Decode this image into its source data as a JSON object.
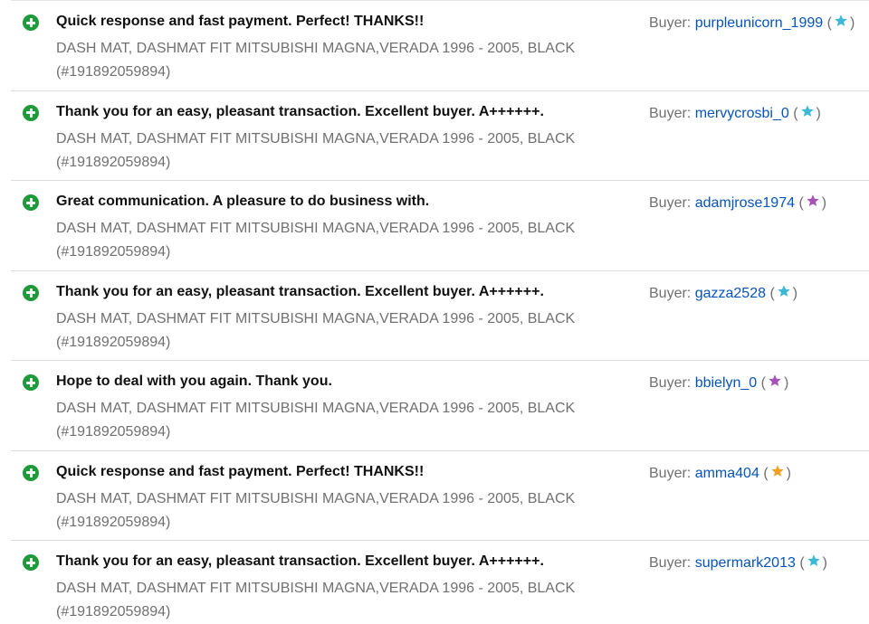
{
  "buyer_label": "Buyer:",
  "feedback": [
    {
      "comment": "Quick response and fast payment. Perfect! THANKS!!",
      "item_title": "DASH MAT, DASHMAT FIT MITSUBISHI MAGNA,VERADA 1996 - 2005, BLACK",
      "item_number": "(#191892059894)",
      "buyer": "purpleunicorn_1999",
      "star_color": "#3bb9d6",
      "icon": "positive-feedback-icon"
    },
    {
      "comment": "Thank you for an easy, pleasant transaction. Excellent buyer. A++++++.",
      "item_title": "DASH MAT, DASHMAT FIT MITSUBISHI MAGNA,VERADA 1996 - 2005, BLACK",
      "item_number": "(#191892059894)",
      "buyer": "mervycrosbi_0",
      "star_color": "#3bb9d6",
      "icon": "positive-feedback-icon"
    },
    {
      "comment": "Great communication. A pleasure to do business with.",
      "item_title": "DASH MAT, DASHMAT FIT MITSUBISHI MAGNA,VERADA 1996 - 2005, BLACK",
      "item_number": "(#191892059894)",
      "buyer": "adamjrose1974",
      "star_color": "#a650b8",
      "icon": "positive-feedback-icon"
    },
    {
      "comment": "Thank you for an easy, pleasant transaction. Excellent buyer. A++++++.",
      "item_title": "DASH MAT, DASHMAT FIT MITSUBISHI MAGNA,VERADA 1996 - 2005, BLACK",
      "item_number": "(#191892059894)",
      "buyer": "gazza2528",
      "star_color": "#3bb9d6",
      "icon": "positive-feedback-icon"
    },
    {
      "comment": "Hope to deal with you again. Thank you.",
      "item_title": "DASH MAT, DASHMAT FIT MITSUBISHI MAGNA,VERADA 1996 - 2005, BLACK",
      "item_number": "(#191892059894)",
      "buyer": "bbielyn_0",
      "star_color": "#a650b8",
      "icon": "positive-feedback-icon"
    },
    {
      "comment": "Quick response and fast payment. Perfect! THANKS!!",
      "item_title": "DASH MAT, DASHMAT FIT MITSUBISHI MAGNA,VERADA 1996 - 2005, BLACK",
      "item_number": "(#191892059894)",
      "buyer": "amma404",
      "star_color": "#f0a020",
      "icon": "positive-feedback-icon"
    },
    {
      "comment": "Thank you for an easy, pleasant transaction. Excellent buyer. A++++++.",
      "item_title": "DASH MAT, DASHMAT FIT MITSUBISHI MAGNA,VERADA 1996 - 2005, BLACK",
      "item_number": "(#191892059894)",
      "buyer": "supermark2013",
      "star_color": "#3bb9d6",
      "icon": "positive-feedback-icon"
    }
  ]
}
